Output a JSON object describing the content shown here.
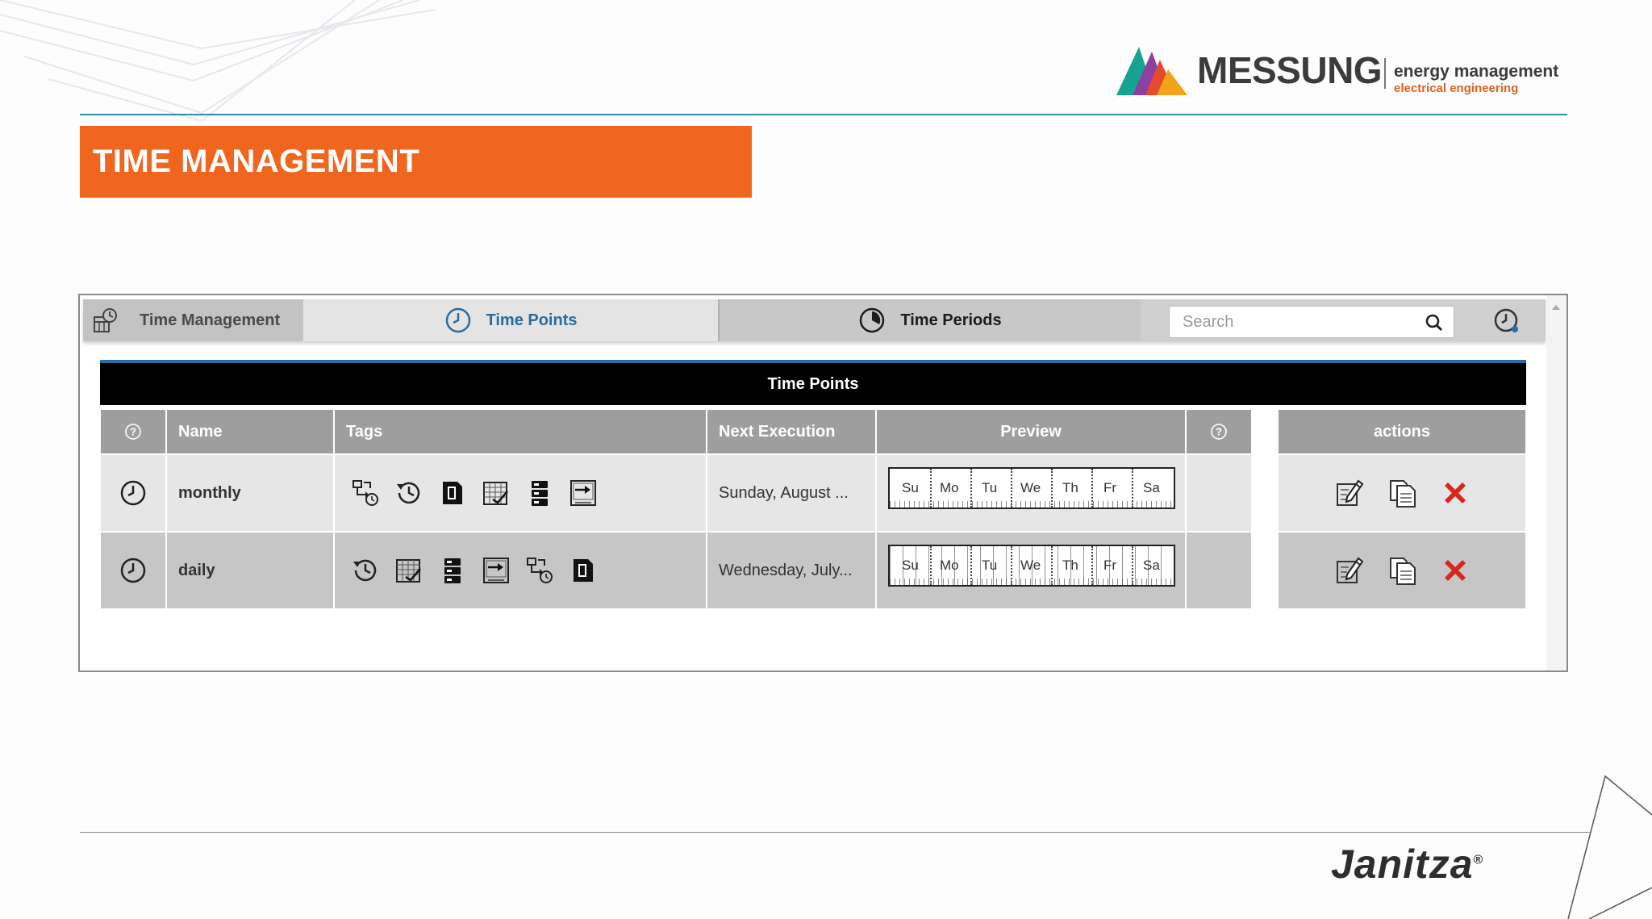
{
  "brand": {
    "name": "MESSUNG",
    "tagline_1": "energy management",
    "tagline_2": "electrical engineering",
    "footer_brand": "Janitza",
    "footer_reg": "®"
  },
  "slide": {
    "title": "TIME MANAGEMENT"
  },
  "app": {
    "tabs": {
      "management": "Time Management",
      "points": "Time Points",
      "periods": "Time Periods"
    },
    "search": {
      "placeholder": "Search",
      "value": ""
    },
    "panel_title": "Time Points",
    "columns": {
      "help": "?",
      "name": "Name",
      "tags": "Tags",
      "next_execution": "Next Execution",
      "preview": "Preview",
      "help2": "?",
      "actions": "actions"
    },
    "weekdays": [
      "Su",
      "Mo",
      "Tu",
      "We",
      "Th",
      "Fr",
      "Sa"
    ],
    "rows": [
      {
        "name": "monthly",
        "next_execution": "Sunday, August ...",
        "tags": [
          "transfer-clock-icon",
          "history-icon",
          "device-icon",
          "calendar-chart-icon",
          "server-icon",
          "import-icon"
        ]
      },
      {
        "name": "daily",
        "next_execution": "Wednesday, July...",
        "tags": [
          "history-icon",
          "calendar-chart-icon",
          "server-icon",
          "import-icon",
          "transfer-clock-icon",
          "device-icon"
        ]
      }
    ]
  },
  "colors": {
    "accent_orange": "#f0661e",
    "accent_blue": "#2a6c9f",
    "rule_teal": "#2a8fa0",
    "delete_red": "#d9261c"
  }
}
